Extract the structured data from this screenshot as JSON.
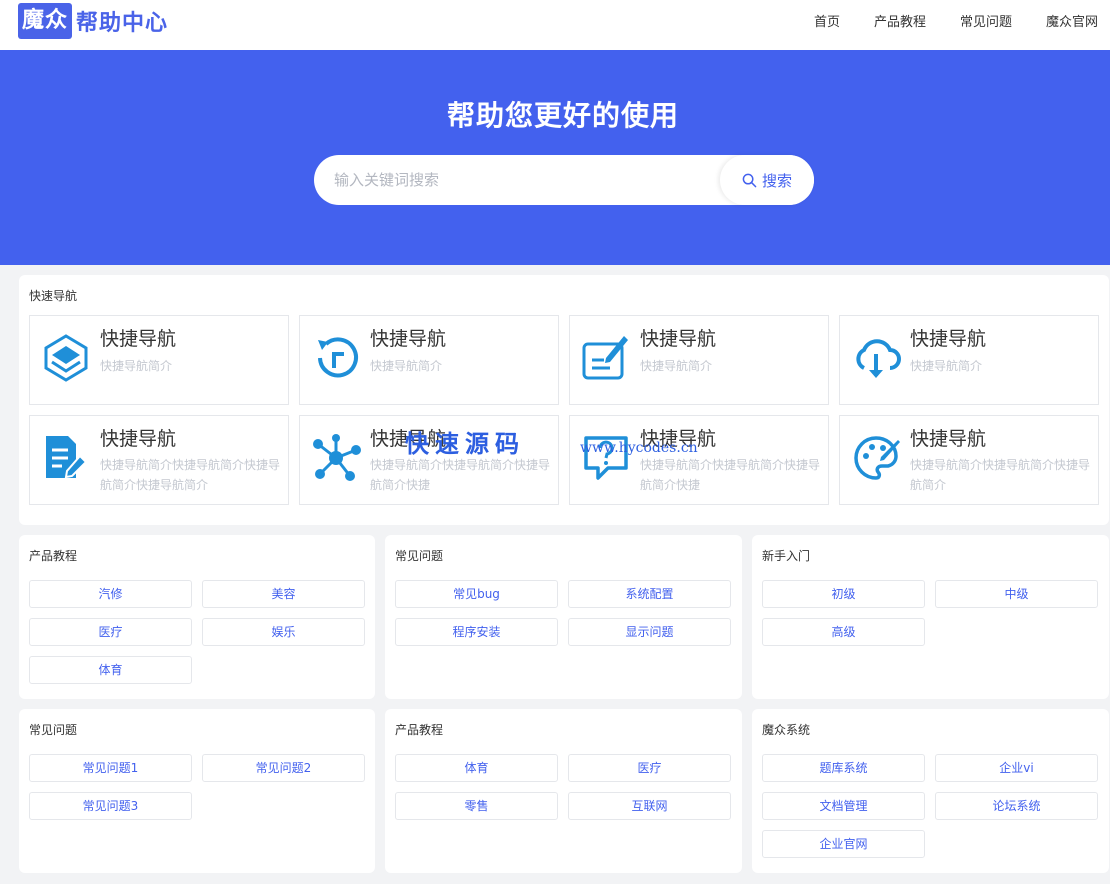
{
  "header": {
    "logo_box": "魔众",
    "logo_text": "帮助中心",
    "nav": [
      "首页",
      "产品教程",
      "常见问题",
      "魔众官网"
    ]
  },
  "hero": {
    "title": "帮助您更好的使用",
    "search_placeholder": "输入关键词搜索",
    "search_button": "搜索"
  },
  "quick_nav": {
    "title": "快速导航",
    "items": [
      {
        "name": "快捷导航",
        "desc": "快捷导航简介",
        "icon": "layers-icon"
      },
      {
        "name": "快捷导航",
        "desc": "快捷导航简介",
        "icon": "refresh-icon"
      },
      {
        "name": "快捷导航",
        "desc": "快捷导航简介",
        "icon": "edit-icon"
      },
      {
        "name": "快捷导航",
        "desc": "快捷导航简介",
        "icon": "cloud-download-icon"
      },
      {
        "name": "快捷导航",
        "desc": "快捷导航简介快捷导航简介快捷导航简介快捷导航简介",
        "icon": "document-edit-icon"
      },
      {
        "name": "快捷导航",
        "desc": "快捷导航简介快捷导航简介快捷导航简介快捷",
        "icon": "network-icon"
      },
      {
        "name": "快捷导航",
        "desc": "快捷导航简介快捷导航简介快捷导航简介快捷",
        "icon": "question-icon"
      },
      {
        "name": "快捷导航",
        "desc": "快捷导航简介快捷导航简介快捷导航简介",
        "icon": "palette-icon"
      }
    ]
  },
  "sections": [
    {
      "title": "产品教程",
      "tags": [
        "汽修",
        "美容",
        "医疗",
        "娱乐",
        "体育"
      ]
    },
    {
      "title": "常见问题",
      "tags": [
        "常见bug",
        "系统配置",
        "程序安装",
        "显示问题"
      ]
    },
    {
      "title": "新手入门",
      "tags": [
        "初级",
        "中级",
        "高级"
      ]
    },
    {
      "title": "常见问题",
      "tags": [
        "常见问题1",
        "常见问题2",
        "常见问题3"
      ]
    },
    {
      "title": "产品教程",
      "tags": [
        "体育",
        "医疗",
        "零售",
        "互联网"
      ]
    },
    {
      "title": "魔众系统",
      "tags": [
        "题库系统",
        "企业vi",
        "文档管理",
        "论坛系统",
        "企业官网"
      ]
    }
  ],
  "watermark": {
    "text": "快速源码",
    "url": "www.hycodes.cn"
  },
  "colors": {
    "primary": "#4361ee",
    "icon": "#1f8fd8"
  }
}
